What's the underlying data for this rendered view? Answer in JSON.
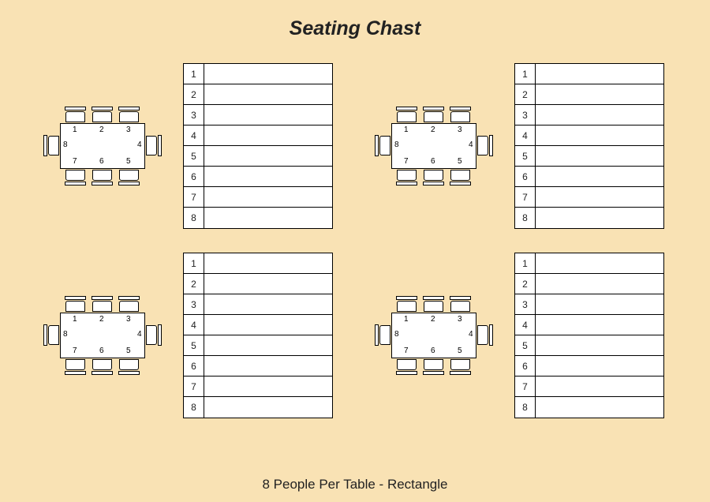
{
  "title": "Seating Chast",
  "footer": "8 People Per Table - Rectangle",
  "blocks": [
    {
      "seat_numbers": [
        "1",
        "2",
        "3",
        "4",
        "5",
        "6",
        "7",
        "8"
      ],
      "list": [
        {
          "num": "1",
          "name": ""
        },
        {
          "num": "2",
          "name": ""
        },
        {
          "num": "3",
          "name": ""
        },
        {
          "num": "4",
          "name": ""
        },
        {
          "num": "5",
          "name": ""
        },
        {
          "num": "6",
          "name": ""
        },
        {
          "num": "7",
          "name": ""
        },
        {
          "num": "8",
          "name": ""
        }
      ]
    },
    {
      "seat_numbers": [
        "1",
        "2",
        "3",
        "4",
        "5",
        "6",
        "7",
        "8"
      ],
      "list": [
        {
          "num": "1",
          "name": ""
        },
        {
          "num": "2",
          "name": ""
        },
        {
          "num": "3",
          "name": ""
        },
        {
          "num": "4",
          "name": ""
        },
        {
          "num": "5",
          "name": ""
        },
        {
          "num": "6",
          "name": ""
        },
        {
          "num": "7",
          "name": ""
        },
        {
          "num": "8",
          "name": ""
        }
      ]
    },
    {
      "seat_numbers": [
        "1",
        "2",
        "3",
        "4",
        "5",
        "6",
        "7",
        "8"
      ],
      "list": [
        {
          "num": "1",
          "name": ""
        },
        {
          "num": "2",
          "name": ""
        },
        {
          "num": "3",
          "name": ""
        },
        {
          "num": "4",
          "name": ""
        },
        {
          "num": "5",
          "name": ""
        },
        {
          "num": "6",
          "name": ""
        },
        {
          "num": "7",
          "name": ""
        },
        {
          "num": "8",
          "name": ""
        }
      ]
    },
    {
      "seat_numbers": [
        "1",
        "2",
        "3",
        "4",
        "5",
        "6",
        "7",
        "8"
      ],
      "list": [
        {
          "num": "1",
          "name": ""
        },
        {
          "num": "2",
          "name": ""
        },
        {
          "num": "3",
          "name": ""
        },
        {
          "num": "4",
          "name": ""
        },
        {
          "num": "5",
          "name": ""
        },
        {
          "num": "6",
          "name": ""
        },
        {
          "num": "7",
          "name": ""
        },
        {
          "num": "8",
          "name": ""
        }
      ]
    }
  ]
}
